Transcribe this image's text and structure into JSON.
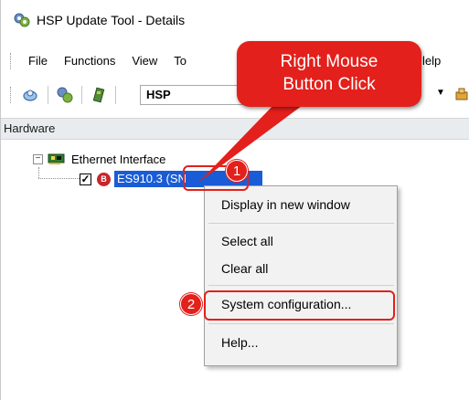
{
  "window": {
    "title": "HSP Update Tool - Details"
  },
  "menubar": {
    "items": [
      "File",
      "Functions",
      "View",
      "To",
      "lelp"
    ]
  },
  "toolbar": {
    "combo_value": "HSP"
  },
  "panel": {
    "header": "Hardware"
  },
  "tree": {
    "root_label": "Ethernet Interface",
    "child_badge": "B",
    "child_label": "ES910.3 (SN"
  },
  "context_menu": {
    "items": [
      "Display in new window",
      "Select all",
      "Clear all",
      "System configuration...",
      "Help..."
    ]
  },
  "annotations": {
    "callout_line1": "Right Mouse",
    "callout_line2": "Button Click",
    "step1": "1",
    "step2": "2"
  },
  "colors": {
    "accent_red": "#e3201b",
    "selection_blue": "#1a5cd6",
    "badge_red": "#c8262b"
  },
  "icons": [
    "app-icon",
    "search-icon",
    "config-icon",
    "chip-icon",
    "network-icon",
    "tool-icon"
  ]
}
